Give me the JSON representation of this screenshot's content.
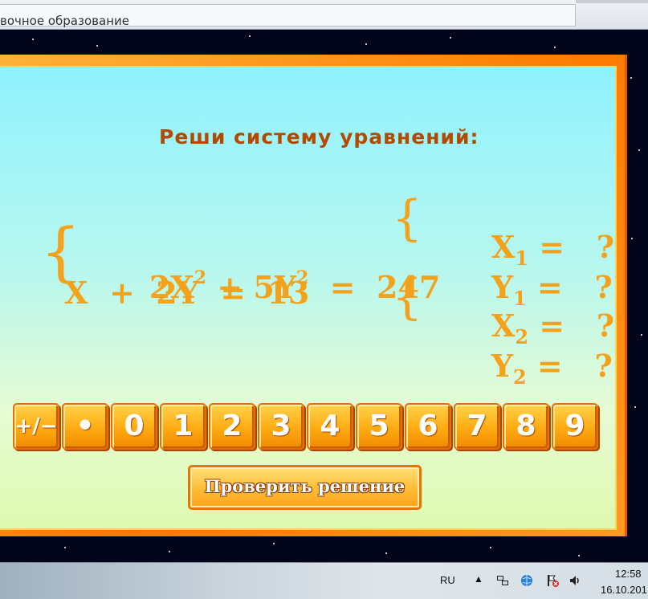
{
  "window": {
    "title": "вочное образование"
  },
  "lesson": {
    "heading": "Реши систему уравнений:",
    "system": {
      "eq1": {
        "part1": "2X",
        "exp1": "2",
        "part2": " + 5Y",
        "exp2": "2",
        "part3": "  =  247"
      },
      "eq2": "X  +  2Y  =  13"
    },
    "answers": [
      {
        "var": "X",
        "sub": "1",
        "rest": " =   ?"
      },
      {
        "var": "Y",
        "sub": "1",
        "rest": " =   ?"
      },
      {
        "var": "X",
        "sub": "2",
        "rest": " =   ?"
      },
      {
        "var": "Y",
        "sub": "2",
        "rest": " =   ?"
      }
    ],
    "keypad": [
      "+/−",
      "•",
      "0",
      "1",
      "2",
      "3",
      "4",
      "5",
      "6",
      "7",
      "8",
      "9"
    ],
    "check_button": "Проверить решение"
  },
  "taskbar": {
    "language": "RU",
    "time": "12:58",
    "date": "16.10.201",
    "tray_icons": [
      "show-hidden-icon",
      "network-icon",
      "globe-icon",
      "action-center-flag-icon",
      "volume-icon"
    ]
  }
}
